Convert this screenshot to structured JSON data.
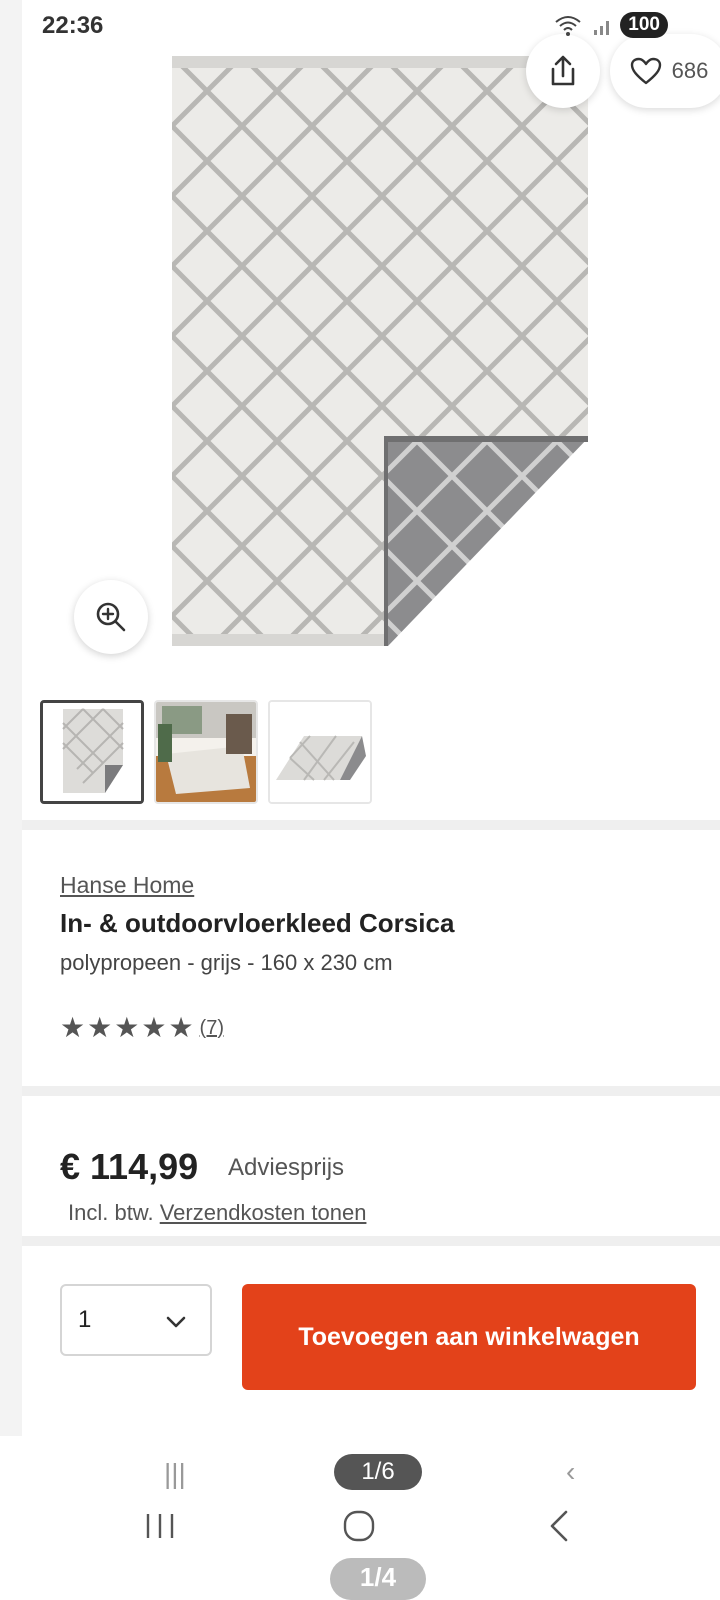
{
  "status_bar": {
    "time": "22:36",
    "battery": "100"
  },
  "product_image": {
    "favorite_count": "686"
  },
  "thumbnails": [
    {
      "name": "rug-front"
    },
    {
      "name": "rug-room"
    },
    {
      "name": "rug-folded"
    }
  ],
  "product": {
    "brand": "Hanse Home",
    "title": "In- & outdoorvloerkleed Corsica",
    "subtitle": "polypropeen - grijs - 160 x 230 cm",
    "rating_stars": 5,
    "review_count": "(7)"
  },
  "pricing": {
    "price": "€ 114,99",
    "price_note": "Adviesprijs",
    "vat_text": "Incl. btw.",
    "shipping_link": "Verzendkosten tonen"
  },
  "purchase": {
    "quantity": "1",
    "add_to_cart_label": "Toevoegen aan winkelwagen"
  },
  "pager": {
    "current": "1/6",
    "secondary": "1/4"
  },
  "colors": {
    "accent": "#e3421a",
    "text": "#222222",
    "muted": "#555555"
  }
}
